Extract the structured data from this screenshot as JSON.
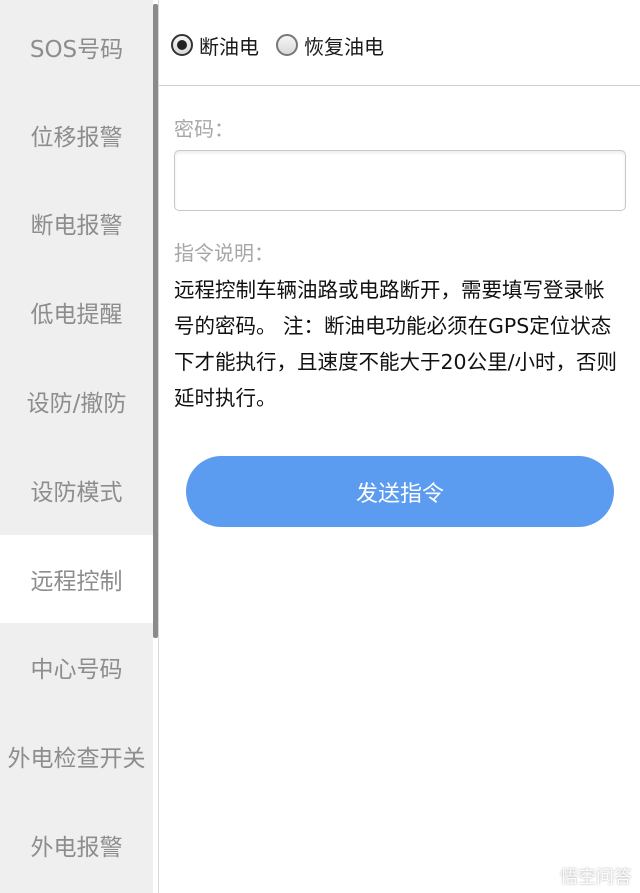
{
  "sidebar": {
    "items": [
      {
        "label": "SOS号码",
        "active": false
      },
      {
        "label": "位移报警",
        "active": false
      },
      {
        "label": "断电报警",
        "active": false
      },
      {
        "label": "低电提醒",
        "active": false
      },
      {
        "label": "设防/撤防",
        "active": false
      },
      {
        "label": "设防模式",
        "active": false
      },
      {
        "label": "远程控制",
        "active": true
      },
      {
        "label": "中心号码",
        "active": false
      },
      {
        "label": "外电检查开关",
        "active": false
      },
      {
        "label": "外电报警",
        "active": false
      }
    ]
  },
  "main": {
    "radio_options": [
      {
        "label": "断油电",
        "checked": true
      },
      {
        "label": "恢复油电",
        "checked": false
      }
    ],
    "password_label": "密码：",
    "password_value": "",
    "desc_label": "指令说明：",
    "desc_text": "远程控制车辆油路或电路断开，需要填写登录帐号的密码。 注：断油电功能必须在GPS定位状态下才能执行，且速度不能大于20公里/小时，否则延时执行。",
    "send_button_label": "发送指令"
  },
  "watermark": {
    "text": "悟空问答",
    "icon": "chat-bubble-icon"
  },
  "colors": {
    "sidebar_bg": "#efefef",
    "sidebar_text": "#8d8d8d",
    "accent": "#5b9bf0"
  }
}
